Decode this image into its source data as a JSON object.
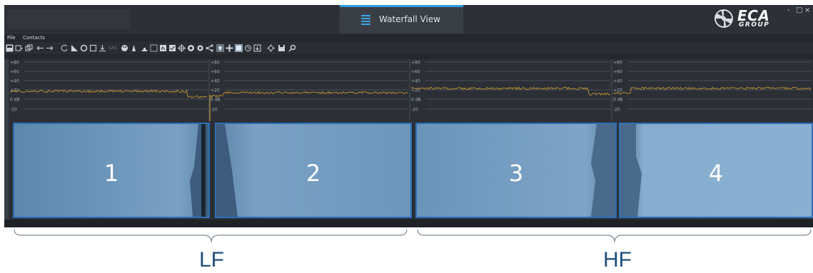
{
  "window": {
    "tab_label": "Waterfall View",
    "logo_text": "ECA",
    "logo_subtext": "GROUP",
    "minimize": "-",
    "maximize": "□",
    "close": "×"
  },
  "menu": {
    "items": [
      "File",
      "Contacts"
    ]
  },
  "toolbar": {
    "icons": [
      "layout-icon",
      "layout-dropdown-icon",
      "copy-icon",
      "arrow-left-icon",
      "arrow-right-icon",
      "rotate-icon",
      "triangle-icon",
      "circle-icon",
      "square-icon",
      "download-icon",
      "sas-icon",
      "palette-icon",
      "person-icon",
      "ship-icon",
      "image-icon",
      "contrast-icon",
      "checkbox-icon",
      "crosshair-icon",
      "target-icon",
      "record-icon",
      "share-icon",
      "up-icon",
      "move-icon",
      "grid-icon",
      "clock-icon",
      "export-icon",
      "target2-icon",
      "save-icon",
      "search-icon"
    ],
    "sas_label": "SAS"
  },
  "signal": {
    "grid_labels": [
      "+80",
      "+60",
      "+40",
      "+20",
      "0 dB",
      "-20"
    ]
  },
  "sonar": {
    "panels": [
      {
        "label": "1"
      },
      {
        "label": "2"
      },
      {
        "label": "3"
      },
      {
        "label": "4"
      }
    ]
  },
  "annotations": {
    "lf_label": "LF",
    "hf_label": "HF"
  },
  "colors": {
    "accent": "#2f9be0",
    "panel_border": "#2e6fb6",
    "signal_line": "#d4a032",
    "annotation": "#1f4e79"
  }
}
